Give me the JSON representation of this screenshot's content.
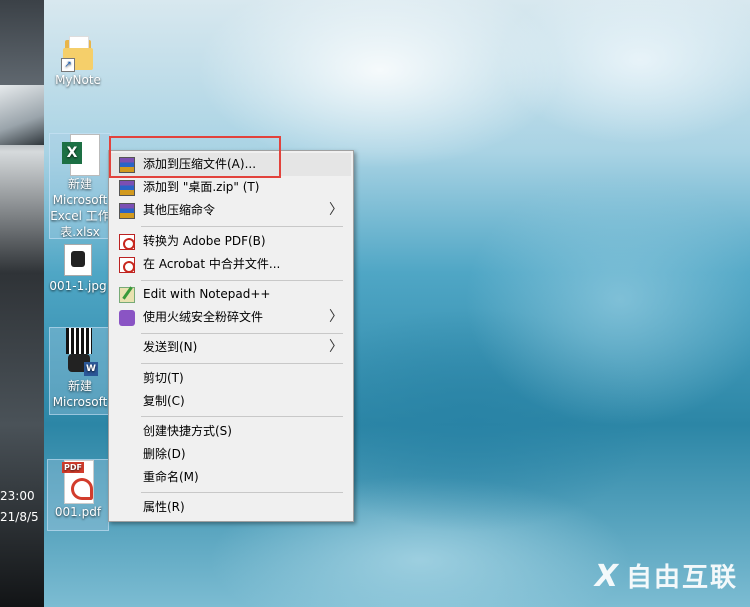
{
  "desktop": {
    "icons": [
      {
        "label": "MyNote",
        "kind": "folder-shortcut"
      },
      {
        "label": "新建\nMicrosoft\nExcel 工作\n表.xlsx",
        "kind": "excel"
      },
      {
        "label": "001-1.jpg",
        "kind": "jpg"
      },
      {
        "label": "新建\nMicrosoft",
        "kind": "word"
      },
      {
        "label": "001.pdf",
        "kind": "pdf"
      }
    ],
    "clock": {
      "time": "23:00",
      "date": "21/8/5"
    }
  },
  "context_menu": {
    "items": [
      {
        "label": "添加到压缩文件(A)...",
        "icon": "winrar-icon",
        "has_submenu": false,
        "highlighted": true
      },
      {
        "label": "添加到 \"桌面.zip\" (T)",
        "icon": "winrar-icon",
        "has_submenu": false
      },
      {
        "label": "其他压缩命令",
        "icon": "winrar-icon",
        "has_submenu": true
      },
      {
        "label": "转换为 Adobe PDF(B)",
        "icon": "adobe-pdf-icon",
        "has_submenu": false
      },
      {
        "label": "在 Acrobat 中合并文件...",
        "icon": "acrobat-merge-icon",
        "has_submenu": false
      },
      {
        "label": "Edit with Notepad++",
        "icon": "notepad-plus-plus-icon",
        "has_submenu": false
      },
      {
        "label": "使用火绒安全粉碎文件",
        "icon": "huorong-shred-icon",
        "has_submenu": true
      },
      {
        "label": "发送到(N)",
        "icon": "",
        "has_submenu": true
      },
      {
        "label": "剪切(T)",
        "icon": "",
        "has_submenu": false
      },
      {
        "label": "复制(C)",
        "icon": "",
        "has_submenu": false
      },
      {
        "label": "创建快捷方式(S)",
        "icon": "",
        "has_submenu": false
      },
      {
        "label": "删除(D)",
        "icon": "",
        "has_submenu": false
      },
      {
        "label": "重命名(M)",
        "icon": "",
        "has_submenu": false
      },
      {
        "label": "属性(R)",
        "icon": "",
        "has_submenu": false
      }
    ],
    "submenu_arrow": "〉"
  },
  "watermark": {
    "mark": "X",
    "text": "自由互联"
  },
  "colors": {
    "annotation_box": "#e2423c",
    "menu_bg": "#f0f0f0",
    "highlight": "#e5e5e5"
  }
}
